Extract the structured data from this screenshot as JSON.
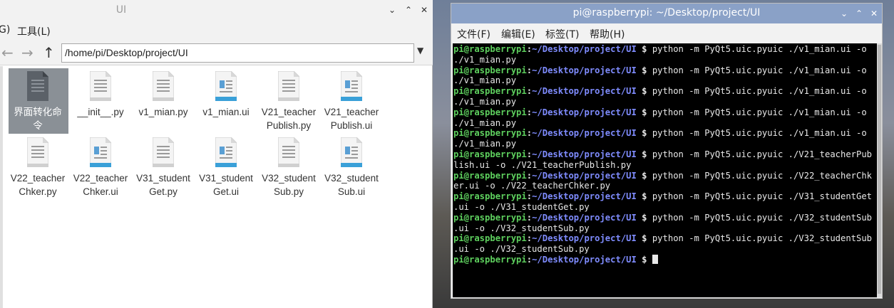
{
  "file_manager": {
    "title": "UI",
    "menu_partial": "G)",
    "menu_tools": "工具(L)",
    "path": "/home/pi/Desktop/project/UI",
    "files": [
      {
        "name": "界面转化命令",
        "line1": "界面转化命",
        "line2": "令",
        "type": "exec",
        "selected": true
      },
      {
        "name": "__init__.py",
        "line1": "__init__.py",
        "line2": "",
        "type": "py"
      },
      {
        "name": "v1_mian.py",
        "line1": "v1_mian.py",
        "line2": "",
        "type": "py"
      },
      {
        "name": "v1_mian.ui",
        "line1": "v1_mian.ui",
        "line2": "",
        "type": "ui"
      },
      {
        "name": "V21_teacherPublish.py",
        "line1": "V21_teacher",
        "line2": "Publish.py",
        "type": "py"
      },
      {
        "name": "V21_teacherPublish.ui",
        "line1": "V21_teacher",
        "line2": "Publish.ui",
        "type": "ui"
      },
      {
        "name": "V22_teacherChker.py",
        "line1": "V22_teacher",
        "line2": "Chker.py",
        "type": "py"
      },
      {
        "name": "V22_teacherChker.ui",
        "line1": "V22_teacher",
        "line2": "Chker.ui",
        "type": "ui"
      },
      {
        "name": "V31_studentGet.py",
        "line1": "V31_student",
        "line2": "Get.py",
        "type": "py"
      },
      {
        "name": "V31_studentGet.ui",
        "line1": "V31_student",
        "line2": "Get.ui",
        "type": "ui"
      },
      {
        "name": "V32_studentSub.py",
        "line1": "V32_student",
        "line2": "Sub.py",
        "type": "py"
      },
      {
        "name": "V32_studentSub.ui",
        "line1": "V32_student",
        "line2": "Sub.ui",
        "type": "ui"
      }
    ]
  },
  "terminal": {
    "title": "pi@raspberrypi: ~/Desktop/project/UI",
    "menu": [
      "文件(F)",
      "编辑(E)",
      "标签(T)",
      "帮助(H)"
    ],
    "prompt_user": "pi@raspberrypi",
    "prompt_sep": ":",
    "prompt_path": "~/Desktop/project/UI",
    "prompt_dollar": " $ ",
    "commands": [
      {
        "cmd": "python -m PyQt5.uic.pyuic ./v1_mian.ui -o",
        "wrap": "./v1_mian.py"
      },
      {
        "cmd": "python -m PyQt5.uic.pyuic ./v1_mian.ui -o",
        "wrap": "./v1_mian.py"
      },
      {
        "cmd": "python -m PyQt5.uic.pyuic ./v1_mian.ui -o",
        "wrap": "./v1_mian.py"
      },
      {
        "cmd": "python -m PyQt5.uic.pyuic ./v1_mian.ui -o",
        "wrap": "./v1_mian.py"
      },
      {
        "cmd": "python -m PyQt5.uic.pyuic ./v1_mian.ui -o",
        "wrap": "./v1_mian.py"
      },
      {
        "cmd": "python -m PyQt5.uic.pyuic ./V21_teacherPub",
        "wrap": "lish.ui -o ./V21_teacherPublish.py"
      },
      {
        "cmd": "python -m PyQt5.uic.pyuic ./V22_teacherChk",
        "wrap": "er.ui -o ./V22_teacherChker.py"
      },
      {
        "cmd": "python -m PyQt5.uic.pyuic ./V31_studentGet",
        "wrap": ".ui -o ./V31_studentGet.py"
      },
      {
        "cmd": "python -m PyQt5.uic.pyuic ./V32_studentSub",
        "wrap": ".ui -o ./V32_studentSub.py"
      },
      {
        "cmd": "python -m PyQt5.uic.pyuic ./V32_studentSub",
        "wrap": ".ui -o ./V32_studentSub.py"
      }
    ]
  },
  "window_buttons": {
    "minimize": "⌄",
    "maximize": "⌃",
    "close": "✕"
  },
  "icons": {
    "back": "←",
    "forward": "→",
    "up": "↑",
    "dropdown": "▼"
  },
  "colors": {
    "prompt_user": "#5ed05e",
    "prompt_path": "#7f8cff",
    "terminal_title_bg": "#8aa1c7",
    "selection": "#8a9096"
  }
}
